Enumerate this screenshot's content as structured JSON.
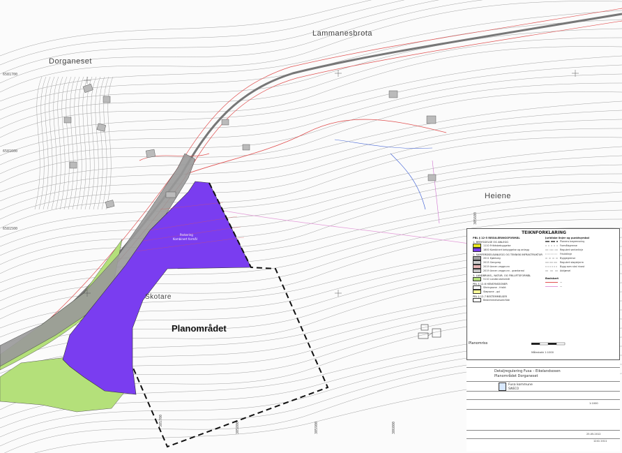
{
  "map": {
    "place_names": {
      "lammanesbrota": "Lammanesbrota",
      "dorganeset": "Dorganeset",
      "heiene": "Heiene",
      "skotare": "Skotare"
    },
    "plan_area_label": "Planområdet",
    "coordinates": {
      "left_1": "6581700",
      "left_2": "6581600",
      "left_3": "6581500",
      "bottom_1": "305700",
      "bottom_2": "305800",
      "bottom_3": "305900",
      "bottom_4": "306000",
      "right_1": "305600"
    },
    "annotations": {
      "parking": "Parkering",
      "area_text": "Kombinert formål"
    }
  },
  "legend": {
    "title": "TEIKNFORKLARING",
    "left_heading": "PBL § 12-5 REGULERINGSFORMÅL",
    "sections": [
      {
        "heading": "1. BEBYGGELSE OG ANLEGG",
        "items": [
          {
            "label": "1110 Fritidsbebyggelse",
            "color": "#e8e820"
          },
          {
            "label": "1800 Kombinert bebyggelse og anlegg",
            "color": "#7a3df0"
          }
        ]
      },
      {
        "heading": "2. SAMFERDSELSANLEGG OG TEKNISK INFRASTRUKTUR",
        "items": [
          {
            "label": "2011 Kjøreveg",
            "color": "#a0a0a0"
          },
          {
            "label": "2015 Gangveg",
            "color": "#d0d0d0"
          },
          {
            "label": "2019 Annen veggrunn",
            "color": "#e6b4b4"
          },
          {
            "label": "2019 Annen veggrunn - grøntareal",
            "color": "#c8c8c8"
          }
        ]
      },
      {
        "heading": "3. LANDBRUKS-, NATUR- OG FRILUFTSFORMÅL",
        "items": [
          {
            "label": "5110 Landbruksformål",
            "color": "#b4e07a"
          }
        ]
      },
      {
        "heading": "PBL § 12-6 HENSYNSSONER",
        "items": [
          {
            "label": "Sikringsone - frisikt",
            "color": "#ffffff"
          },
          {
            "label": "Støysone - gul",
            "color": "#ffff99"
          }
        ]
      },
      {
        "heading": "PBL § 12-7 BESTEMMELSER",
        "items": [
          {
            "label": "Bestemmelsesområde",
            "color": "#ffffff"
          }
        ]
      }
    ],
    "right_heading": "Juridiske linjer og punktsymbol",
    "line_items": [
      "Planens begrensning",
      "Formålsgrense",
      "Regulert senterlinje",
      "Frisiktlinje",
      "Byggegrense",
      "Regulert støyskjerm",
      "Bygg som skal rivast",
      "Avkjørsel"
    ],
    "other_heading": "Basiskart",
    "planomriss_label": "Planomriss",
    "scale_label": "Målestokk 1:1000"
  },
  "titleblock": {
    "municipality": "Fusa kommune",
    "plan_title": "Detaljregulering Fusa – Eikelandsosen",
    "plan_subtitle": "Planområdet Dorganeset",
    "client": "Fusa kommune",
    "consultant": "SWECO",
    "plan_id": "1241 2011",
    "scale": "1:1000",
    "date": "25.05.2012"
  },
  "colors": {
    "purple": "#7a3df0",
    "green": "#b4e07a",
    "road_gray": "#8a8a8a",
    "contour": "#8a8a8a",
    "red_line": "#e05050"
  }
}
